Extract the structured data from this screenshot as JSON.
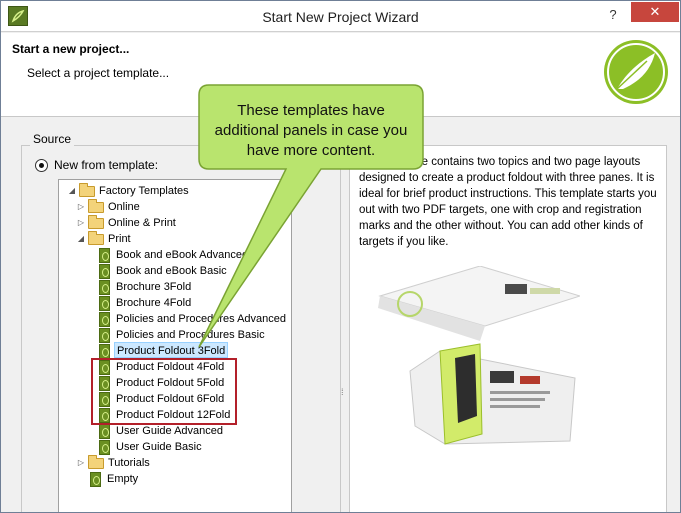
{
  "window": {
    "title": "Start New Project Wizard",
    "help_glyph": "?",
    "close_glyph": "✕"
  },
  "header": {
    "title": "Start a new project...",
    "subtitle": "Select a project template..."
  },
  "source": {
    "group_label": "Source",
    "radio_label": "New from template:"
  },
  "tree": {
    "items": [
      {
        "label": "Factory Templates",
        "type": "folder",
        "expanded": true
      },
      {
        "label": "Online",
        "type": "folder",
        "expanded": false
      },
      {
        "label": "Online & Print",
        "type": "folder",
        "expanded": false
      },
      {
        "label": "Print",
        "type": "folder",
        "expanded": true
      },
      {
        "label": "Book and eBook Advanced",
        "type": "template"
      },
      {
        "label": "Book and eBook Basic",
        "type": "template"
      },
      {
        "label": "Brochure 3Fold",
        "type": "template"
      },
      {
        "label": "Brochure 4Fold",
        "type": "template"
      },
      {
        "label": "Policies and Procedures Advanced",
        "type": "template"
      },
      {
        "label": "Policies and Procedures Basic",
        "type": "template"
      },
      {
        "label": "Product Foldout 3Fold",
        "type": "template",
        "selected": true
      },
      {
        "label": "Product Foldout 4Fold",
        "type": "template"
      },
      {
        "label": "Product Foldout 5Fold",
        "type": "template"
      },
      {
        "label": "Product Foldout 6Fold",
        "type": "template"
      },
      {
        "label": "Product Foldout 12Fold",
        "type": "template"
      },
      {
        "label": "User Guide Advanced",
        "type": "template"
      },
      {
        "label": "User Guide Basic",
        "type": "template"
      },
      {
        "label": "Tutorials",
        "type": "folder",
        "expanded": false
      },
      {
        "label": "Empty",
        "type": "template"
      }
    ]
  },
  "description": {
    "text": "This template contains two topics and two page layouts designed to create a product foldout with three panes.  It is ideal for brief product instructions.  This template starts you out with two PDF targets, one with crop and registration marks and the other without.  You can add other kinds of targets if you like."
  },
  "callout": {
    "text": "These templates have additional panels in case you have more content."
  },
  "colors": {
    "callout_fill": "#b9e46e",
    "highlight_box": "#b3202a",
    "brand_green": "#8cbf26",
    "close_button": "#c7463d"
  }
}
